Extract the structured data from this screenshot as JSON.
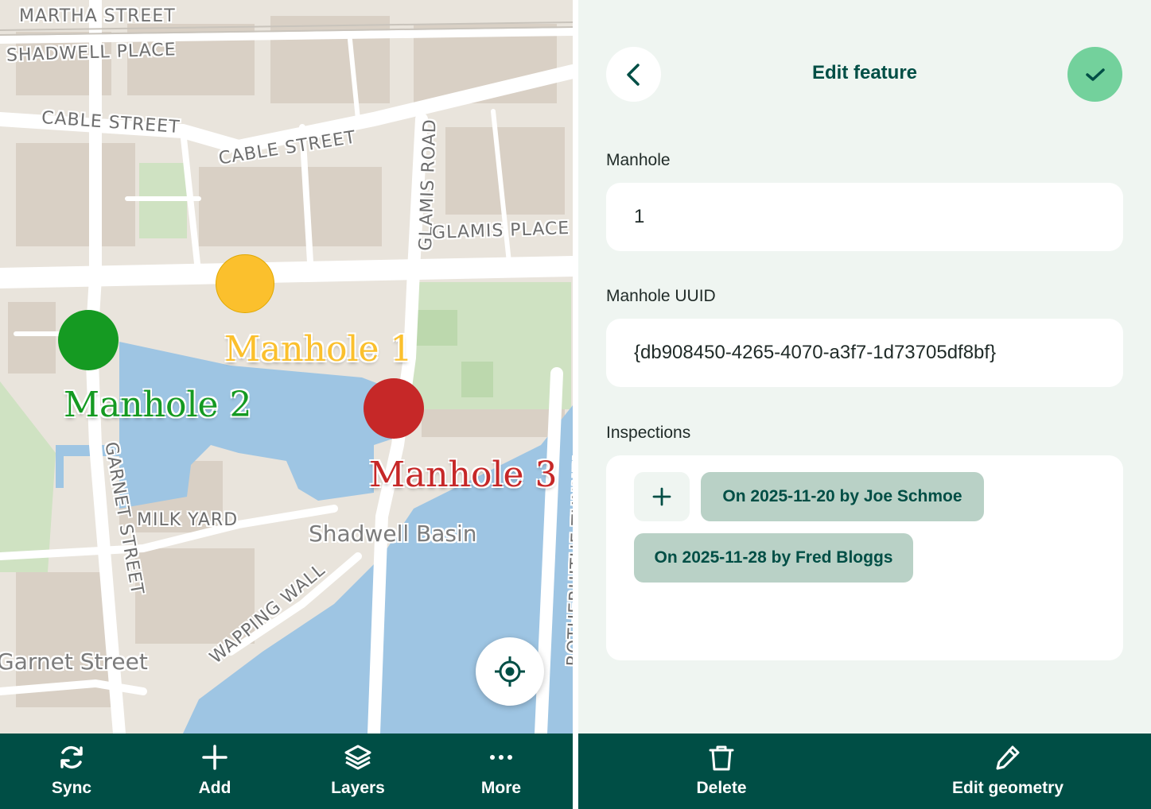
{
  "map": {
    "street_labels": {
      "martha_street": "MARTHA STREET",
      "shadwell_place": "SHADWELL PLACE",
      "cable_street_1": "CABLE STREET",
      "cable_street_2": "CABLE STREET",
      "glamis_road": "GLAMIS ROAD",
      "glamis_place": "GLAMIS PLACE",
      "garnet_street": "GARNET STREET",
      "milk_yard": "MILK YARD",
      "wapping_wall": "WAPPING WALL",
      "rotherhithe_tunnel": "ROTHERHITHE TUNNEL",
      "shadwell_basin": "Shadwell Basin",
      "garnet_street_big": "Garnet Street"
    },
    "markers": [
      {
        "label": "Manhole 1",
        "color": "#fbc02d"
      },
      {
        "label": "Manhole 2",
        "color": "#159a22"
      },
      {
        "label": "Manhole 3",
        "color": "#c62828"
      }
    ],
    "locate_icon": "locate-crosshair-icon"
  },
  "map_toolbar": {
    "sync": {
      "label": "Sync",
      "icon": "sync-icon"
    },
    "add": {
      "label": "Add",
      "icon": "plus-icon"
    },
    "layers": {
      "label": "Layers",
      "icon": "layers-icon"
    },
    "more": {
      "label": "More",
      "icon": "more-dots-icon"
    }
  },
  "form": {
    "title": "Edit feature",
    "back_icon": "chevron-left-icon",
    "confirm_icon": "checkmark-icon",
    "fields": {
      "manhole": {
        "label": "Manhole",
        "value": "1"
      },
      "uuid": {
        "label": "Manhole UUID",
        "value": "{db908450-4265-4070-a3f7-1d73705df8bf}"
      },
      "inspections": {
        "label": "Inspections",
        "add_icon": "plus-icon",
        "items": [
          "On 2025-11-20 by Joe Schmoe",
          "On 2025-11-28 by Fred Bloggs"
        ]
      }
    }
  },
  "form_toolbar": {
    "delete": {
      "label": "Delete",
      "icon": "trash-icon"
    },
    "edit_geometry": {
      "label": "Edit geometry",
      "icon": "pencil-icon"
    }
  },
  "colors": {
    "toolbar_bg": "#004e45",
    "form_bg": "#eff5f1",
    "confirm_green": "#73d19c",
    "chip_bg": "#b9d1c6",
    "water": "#9ec5e3"
  }
}
